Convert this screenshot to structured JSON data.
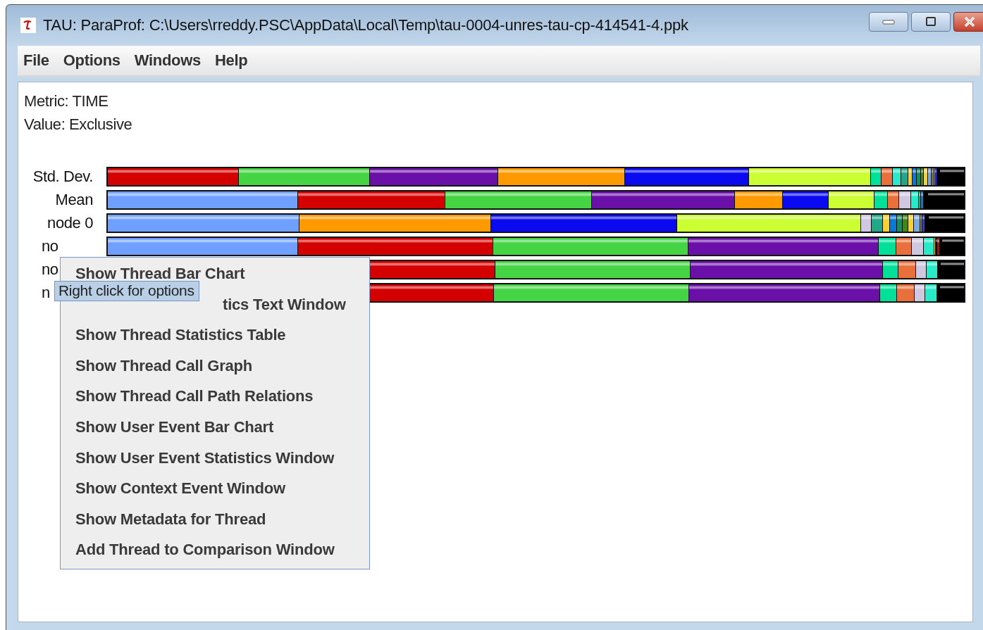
{
  "window": {
    "title": "TAU: ParaProf: C:\\Users\\rreddy.PSC\\AppData\\Local\\Temp\\tau-0004-unres-tau-cp-414541-4.ppk"
  },
  "menu_bar": [
    "File",
    "Options",
    "Windows",
    "Help"
  ],
  "info": [
    "Metric: TIME",
    "Value: Exclusive"
  ],
  "rows": [
    {
      "label": "Std. Dev."
    },
    {
      "label": "Mean"
    },
    {
      "label": "node 0"
    },
    {
      "label": "no",
      "kind": "cut"
    },
    {
      "label": "no",
      "kind": "cut"
    },
    {
      "label": "n",
      "kind": "cut"
    }
  ],
  "context_menu": [
    {
      "label": "Show Thread Bar Chart",
      "kind": "item"
    },
    {
      "label": "tics Text Window",
      "kind": "covered"
    },
    {
      "label": "Show Thread Statistics Table",
      "kind": "item"
    },
    {
      "label": "Show Thread Call Graph",
      "kind": "item"
    },
    {
      "label": "Show Thread Call Path Relations",
      "kind": "item"
    },
    {
      "label": "Show User Event Bar Chart",
      "kind": "item"
    },
    {
      "label": "Show User Event Statistics Window",
      "kind": "item"
    },
    {
      "label": "Show Context Event Window",
      "kind": "item"
    },
    {
      "label": "Show Metadata for Thread",
      "kind": "item"
    },
    {
      "label": "Add Thread to Comparison Window",
      "kind": "item"
    }
  ],
  "tooltip": "Right click for options"
}
